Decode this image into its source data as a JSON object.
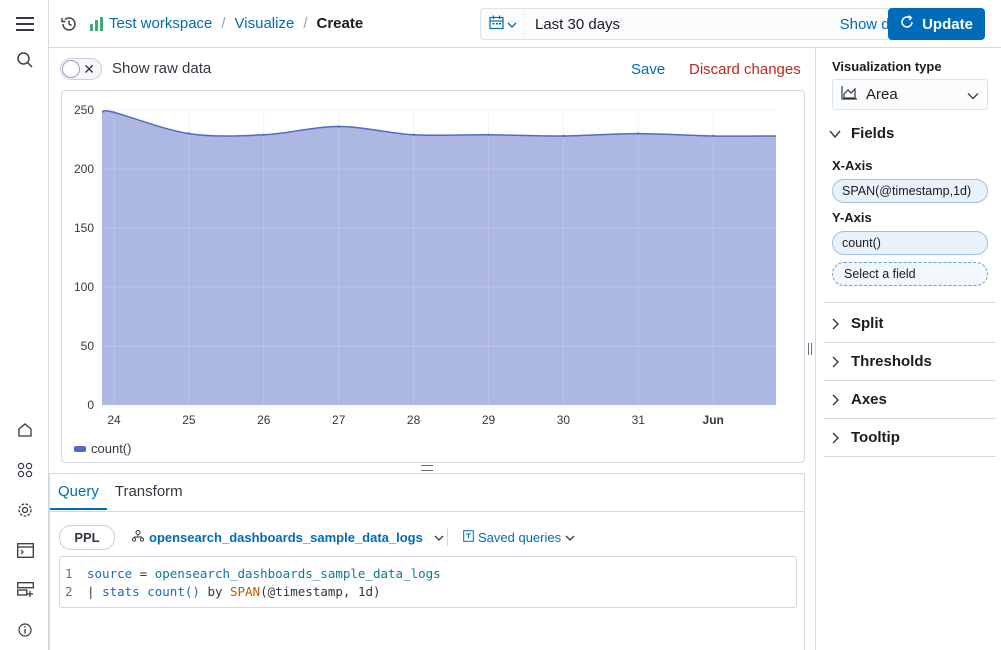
{
  "header": {
    "breadcrumbs": [
      "Test workspace",
      "Visualize",
      "Create"
    ],
    "date_range": "Last 30 days",
    "show_dates_label": "Show dates",
    "update_label": "Update"
  },
  "toolbar": {
    "raw_data_label": "Show raw data",
    "raw_data_enabled": false,
    "save_label": "Save",
    "discard_label": "Discard changes"
  },
  "colors": {
    "accent": "#006bb8",
    "danger": "#bd271e",
    "series_fill": "#a8b4e0",
    "series_line": "#5469c7"
  },
  "chart_data": {
    "type": "area",
    "categories": [
      "24",
      "25",
      "26",
      "27",
      "28",
      "29",
      "30",
      "31",
      "Jun"
    ],
    "series": [
      {
        "name": "count()",
        "values": [
          248,
          230,
          229,
          236,
          229,
          229,
          228,
          230,
          228
        ]
      }
    ],
    "yticks": [
      250,
      200,
      150,
      100,
      50,
      0
    ],
    "ylim": [
      0,
      250
    ],
    "grid": true,
    "legend_position": "bottom-left"
  },
  "query": {
    "tabs": [
      "Query",
      "Transform"
    ],
    "active_tab": "Query",
    "language_label": "PPL",
    "source_name": "opensearch_dashboards_sample_data_logs",
    "saved_queries_label": "Saved queries",
    "lines": [
      {
        "num": "1",
        "tokens": [
          {
            "t": "source",
            "c": "tok-kw"
          },
          {
            "t": " = ",
            "c": "tok-plain"
          },
          {
            "t": "opensearch_dashboards_sample_data_logs",
            "c": "tok-str"
          }
        ]
      },
      {
        "num": "2",
        "tokens": [
          {
            "t": "| ",
            "c": "tok-plain"
          },
          {
            "t": "stats",
            "c": "tok-kw"
          },
          {
            "t": " ",
            "c": "tok-plain"
          },
          {
            "t": "count()",
            "c": "tok-kw"
          },
          {
            "t": " by ",
            "c": "tok-plain"
          },
          {
            "t": "SPAN",
            "c": "tok-fn"
          },
          {
            "t": "(@timestamp, 1d)",
            "c": "tok-plain"
          }
        ]
      }
    ]
  },
  "config": {
    "viz_type_title": "Visualization type",
    "viz_type_value": "Area",
    "fields_title": "Fields",
    "x_axis_label": "X-Axis",
    "x_axis_value": "SPAN(@timestamp,1d)",
    "y_axis_label": "Y-Axis",
    "y_axis_value": "count()",
    "y_axis_placeholder": "Select a field",
    "sections": [
      "Split",
      "Thresholds",
      "Axes",
      "Tooltip"
    ]
  },
  "nav_icons": [
    "menu-icon",
    "search-icon",
    "home-icon",
    "apps-icon",
    "settings-icon",
    "console-icon",
    "data-source-icon",
    "help-icon"
  ]
}
